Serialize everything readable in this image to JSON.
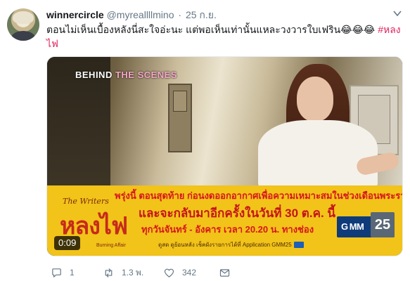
{
  "tweet": {
    "author_name": "winnercircle",
    "handle": "@myreallllmino",
    "separator": "·",
    "time": "25 ก.ย.",
    "text_main": "ตอนไม่เห็นเบื้องหลังนี่สะใจอ่ะนะ แต่พอเห็นเท่านั้นแหละวงวารใบเฟริน😂😂😂 ",
    "hashtag": "#หลงไฟ"
  },
  "media": {
    "overlay_label_prefix": "BEHIND ",
    "overlay_label_accent": "THE SCENES",
    "banner": {
      "line1": "พรุ่งนี้ ตอนสุดท้าย ก่อนงดออกอากาศเพื่อความเหมาะสมในช่วงเดือนพระราชพิธี",
      "line2": "และจะกลับมาอีกครั้งในวันที่ 30 ต.ค. นี้",
      "line3": "ทุกวันจันทร์ - อังคาร เวลา 20.20 น. ทางช่อง",
      "line4": "ดูสด ดูย้อนหลัง เช็คผังรายการได้ที่ Application GMM25"
    },
    "logo": {
      "small": "The Writers",
      "main": "หลงไฟ",
      "sub": "Burning Affair"
    },
    "channel": {
      "name": "G MM",
      "number": "25"
    },
    "duration": "0:09"
  },
  "actions": {
    "reply_count": "1",
    "retweet_count": "1.3 พ.",
    "like_count": "342"
  },
  "colors": {
    "hashtag": "#e0245e",
    "secondary_text": "#657786",
    "banner_yellow": "#f2c318"
  },
  "icons": [
    "caret-down-icon",
    "reply-icon",
    "retweet-icon",
    "heart-icon",
    "direct-message-icon"
  ]
}
